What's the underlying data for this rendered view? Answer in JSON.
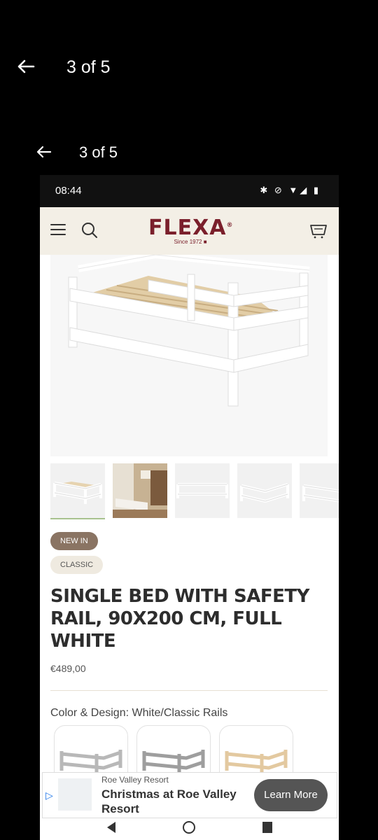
{
  "viewer": {
    "back_icon": "arrow-left-icon",
    "counter": "3 of 5"
  },
  "inner_viewer": {
    "back_icon": "arrow-left-icon",
    "counter": "3 of 5"
  },
  "status_bar": {
    "time": "08:44",
    "icons": "✱ ⊘ ▼◢ ▮"
  },
  "site": {
    "logo": "FLEXA",
    "logo_mark": "®",
    "tagline": "Since 1972 ■",
    "brand_color": "#7a1f2b",
    "header_bg": "#f3efe6"
  },
  "product": {
    "badges": [
      "NEW IN",
      "CLASSIC"
    ],
    "title": "SINGLE BED WITH SAFETY RAIL, 90X200 CM, FULL WHITE",
    "price": "€489,00",
    "color_label": "Color & Design: White/Classic Rails"
  },
  "gallery": {
    "thumbnail_count": 5,
    "selected_index": 0
  },
  "ad": {
    "source": "Roe Valley Resort",
    "headline": "Christmas at Roe Valley Resort",
    "cta": "Learn More"
  }
}
